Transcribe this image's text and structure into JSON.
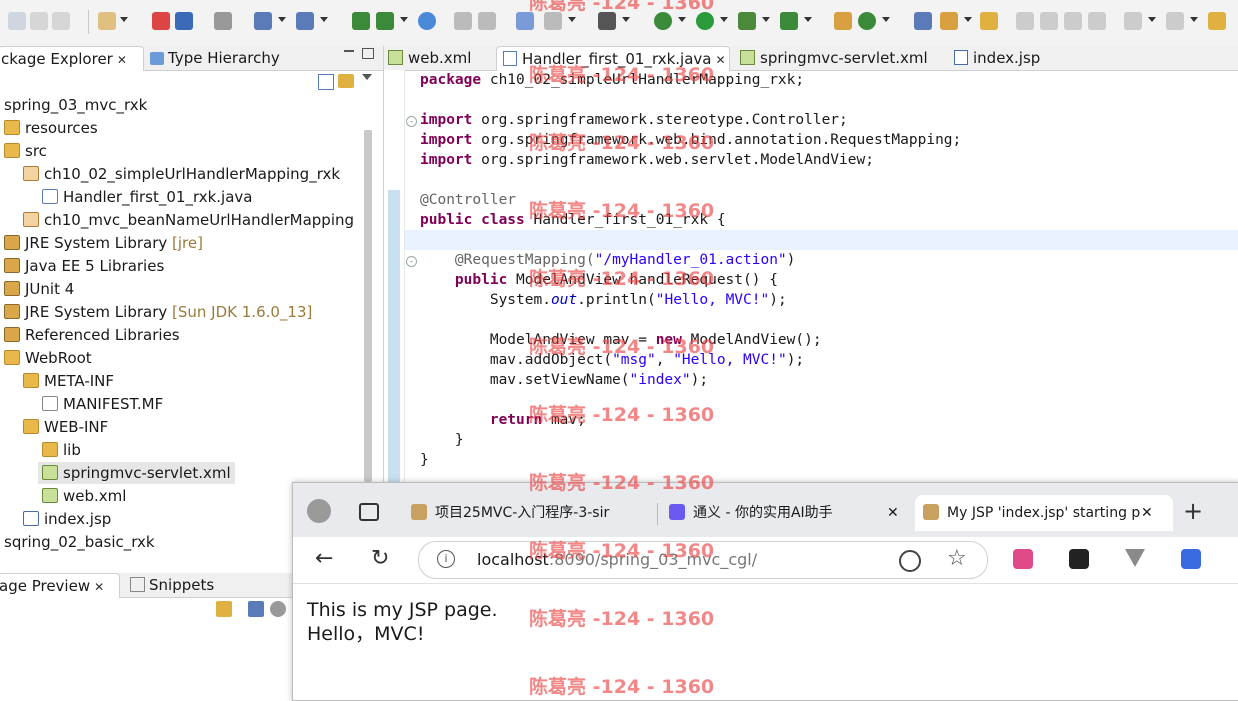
{
  "explorer": {
    "tabs": [
      {
        "label": "ckage Explorer",
        "close": "✕"
      },
      {
        "label": "Type Hierarchy"
      }
    ],
    "tree": [
      {
        "label": "spring_03_mvc_rxk",
        "extra": ""
      },
      {
        "label": "resources",
        "extra": ""
      },
      {
        "label": "src",
        "extra": ""
      },
      {
        "label": "ch10_02_simpleUrlHandlerMapping_rxk",
        "extra": ""
      },
      {
        "label": "Handler_first_01_rxk.java",
        "extra": ""
      },
      {
        "label": "ch10_mvc_beanNameUrlHandlerMapping",
        "extra": ""
      },
      {
        "label": "JRE System Library",
        "extra": "[jre]"
      },
      {
        "label": "Java EE 5 Libraries",
        "extra": ""
      },
      {
        "label": "JUnit 4",
        "extra": ""
      },
      {
        "label": "JRE System Library",
        "extra": "[Sun JDK 1.6.0_13]"
      },
      {
        "label": "Referenced Libraries",
        "extra": ""
      },
      {
        "label": "WebRoot",
        "extra": ""
      },
      {
        "label": "META-INF",
        "extra": ""
      },
      {
        "label": "MANIFEST.MF",
        "extra": ""
      },
      {
        "label": "WEB-INF",
        "extra": ""
      },
      {
        "label": "lib",
        "extra": ""
      },
      {
        "label": "springmvc-servlet.xml",
        "extra": ""
      },
      {
        "label": "web.xml",
        "extra": ""
      },
      {
        "label": "index.jsp",
        "extra": ""
      },
      {
        "label": "sqring_02_basic_rxk",
        "extra": ""
      }
    ]
  },
  "editor": {
    "tabs": [
      {
        "label": "web.xml"
      },
      {
        "label": "Handler_first_01_rxk.java",
        "close": "✕"
      },
      {
        "label": "springmvc-servlet.xml"
      },
      {
        "label": "index.jsp"
      }
    ],
    "code": {
      "l1_kw": "package",
      "l1_rest": " ch10_02_simpleUrlHandlerMapping_rxk;",
      "l3_kw": "import",
      "l3_rest": " org.springframework.stereotype.Controller;",
      "l4_kw": "import",
      "l4_rest": " org.springframework.web.bind.annotation.RequestMapping;",
      "l5_kw": "import",
      "l5_rest": " org.springframework.web.servlet.ModelAndView;",
      "l7_ann": "@Controller",
      "l8_kw": "public class",
      "l8_rest": " Handler_first_01_rxk {",
      "l10_ann": "    @RequestMapping(",
      "l10_str": "\"/myHandler_01.action\"",
      "l10_end": ")",
      "l11_kw": "    public",
      "l11_rest": " ModelAndView handleRequest() {",
      "l12_a": "        System.",
      "l12_fld": "out",
      "l12_b": ".println(",
      "l12_str": "\"Hello, MVC!\"",
      "l12_end": ");",
      "l14_a": "        ModelAndView mav = ",
      "l14_kw": "new",
      "l14_b": " ModelAndView();",
      "l15_a": "        mav.addObject(",
      "l15_s1": "\"msg\"",
      "l15_b": ", ",
      "l15_s2": "\"Hello, MVC!\"",
      "l15_end": ");",
      "l16_a": "        mav.setViewName(",
      "l16_str": "\"index\"",
      "l16_end": ");",
      "l18_kw": "        return",
      "l18_rest": " mav;",
      "l19": "    }",
      "l20": "}"
    }
  },
  "bottom_left": {
    "tabs": [
      {
        "label": "age Preview",
        "close": "✕"
      },
      {
        "label": "Snippets"
      }
    ]
  },
  "browser": {
    "tabs": [
      {
        "label": "项目25MVC-入门程序-3-sir"
      },
      {
        "label": "通义 - 你的实用AI助手",
        "close": "✕"
      },
      {
        "label": "My JSP 'index.jsp' starting p",
        "close": "✕"
      }
    ],
    "new_tab": "+",
    "url_host": "localhost",
    "url_rest": ":8090/spring_03_mvc_cgl/",
    "page_line1": "This is my JSP page.",
    "page_line2": "Hello，MVC!"
  },
  "watermark": "陈葛亮 -124 - 1360"
}
